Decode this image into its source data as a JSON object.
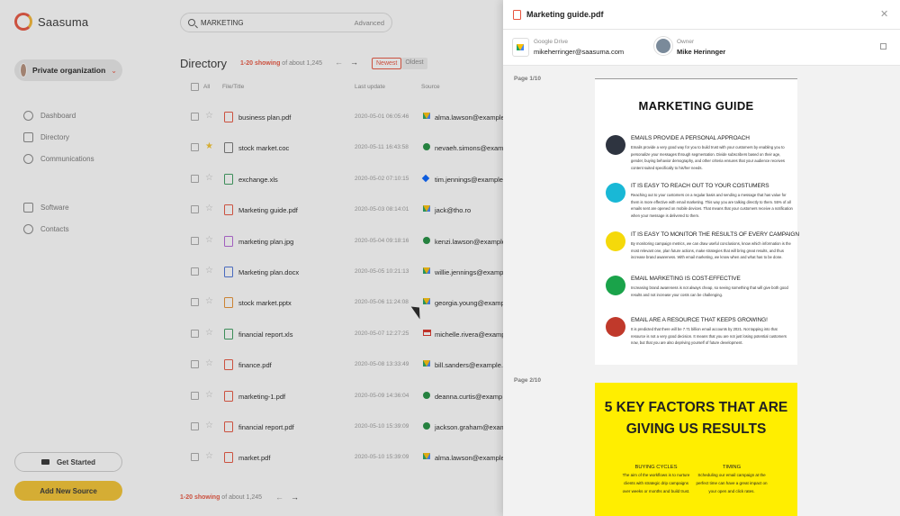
{
  "app": {
    "logo_text": "Saasuma",
    "org_label": "Private organization",
    "nav": [
      "Dashboard",
      "Directory",
      "Communications"
    ],
    "nav2": [
      "Software",
      "Contacts"
    ],
    "get_started": "Get Started",
    "add_source": "Add New Source"
  },
  "search": {
    "value": "MARKETING",
    "advanced": "Advanced"
  },
  "directory": {
    "title": "Directory",
    "showing": "1-20 showing",
    "of_total": "of about 1,245",
    "sort_newest": "Newest",
    "sort_oldest": "Oldest",
    "col_all": "All",
    "col_file": "File/Title",
    "col_update": "Last update",
    "col_source": "Source"
  },
  "rows": [
    {
      "name": "business plan.pdf",
      "type": "pdf",
      "date": "2020-05-01 06:05:46",
      "source": "drive",
      "email": "alma.lawson@example",
      "fav": false
    },
    {
      "name": "stock market.coc",
      "type": "coc",
      "date": "2020-05-11 16:43:58",
      "source": "hangout",
      "email": "nevaeh.simons@examp",
      "fav": true
    },
    {
      "name": "exchange.xls",
      "type": "xls",
      "date": "2020-05-02 07:10:15",
      "source": "dropbox",
      "email": "tim.jennings@example",
      "fav": false
    },
    {
      "name": "Marketing guide.pdf",
      "type": "pdf",
      "date": "2020-05-03 08:14:01",
      "source": "drive",
      "email": "jack@tho.ro",
      "fav": false
    },
    {
      "name": "marketing plan.jpg",
      "type": "jpg",
      "date": "2020-05-04 09:18:16",
      "source": "hangout",
      "email": "kenzi.lawson@example",
      "fav": false
    },
    {
      "name": "Marketing plan.docx",
      "type": "docx",
      "date": "2020-05-05 10:21:13",
      "source": "drive",
      "email": "willie.jennings@examp",
      "fav": false
    },
    {
      "name": "stock market.pptx",
      "type": "pptx",
      "date": "2020-05-06 11:24:08",
      "source": "drive",
      "email": "georgia.young@examp",
      "fav": false
    },
    {
      "name": "financial report.xls",
      "type": "xls",
      "date": "2020-05-07 12:27:25",
      "source": "gmail",
      "email": "michelle.rivera@examp",
      "fav": false
    },
    {
      "name": "finance.pdf",
      "type": "pdf",
      "date": "2020-05-08 13:33:49",
      "source": "drive",
      "email": "bill.sanders@example.",
      "fav": false
    },
    {
      "name": "marketing-1.pdf",
      "type": "pdf",
      "date": "2020-05-09 14:36:04",
      "source": "hangout",
      "email": "deanna.curtis@examp",
      "fav": false
    },
    {
      "name": "financial report.pdf",
      "type": "pdf",
      "date": "2020-05-10 15:39:09",
      "source": "hangout",
      "email": "jackson.graham@exam",
      "fav": false
    },
    {
      "name": "market.pdf",
      "type": "pdf",
      "date": "2020-05-10 15:39:09",
      "source": "drive",
      "email": "alma.lawson@example",
      "fav": false
    }
  ],
  "footer": {
    "showing": "1-20 showing",
    "of_total": "of about 1,245"
  },
  "panel": {
    "title": "Marketing guide.pdf",
    "source_label": "Google Drive",
    "source_account": "mikeherringer@saasuma.com",
    "owner_label": "Owner",
    "owner_name": "Mike Herinnger",
    "page1_label": "Page 1/10",
    "page2_label": "Page 2/10"
  },
  "pdf1": {
    "heading": "MARKETING GUIDE",
    "sections": [
      {
        "title": "EMAILS PROVIDE A PERSONAL APPROACH",
        "color": "#2e3440",
        "body": "Emails provide a very good way for you to build trust with your customers by enabling you to personalize your messages through segmentation. Divide subscribers based on their age, gender, buying behavior demography, and other criteria ensures that your audience receives content suited specifically to his/her needs."
      },
      {
        "title": "IT IS EASY TO REACH OUT TO YOUR COSTUMERS",
        "color": "#19b8d6",
        "body": "Reaching out to your customers on a regular basis and sending a message that has value for them is more effective with email marketing. This way you are talking directly to them. 55% of all emails sent are opened on mobile devices. That means that your customers receive a notification when your message is delivered to them."
      },
      {
        "title": "IT IS EASY TO MONITOR THE RESULTS OF EVERY CAMPAIGN",
        "color": "#f5d90a",
        "body": "By monitoring campaign metrics, we can draw useful conclusions, know which information is the most relevant one, plan future actions, make strategies that will bring great results, and thus increase brand awareness. With email marketing, we know when and what has to be done."
      },
      {
        "title": "EMAIL MARKETING IS COST-EFFECTIVE",
        "color": "#1aa34a",
        "body": "Increasing brand awareness is not always cheap, so seeing something that will give both good results and not increase your costs can be challenging."
      },
      {
        "title": "EMAIL ARE A RESOURCE THAT KEEPS GROWING!",
        "color": "#c0392b",
        "body": "It is predicted that there will be 7.71 billion email accounts by 2021. Not tapping into that resource is not a very good decision. It means that you are not just losing potential customers now, but that you are also depriving yourself of future development."
      }
    ]
  },
  "pdf2": {
    "heading_line1": "5 KEY FACTORS THAT ARE",
    "heading_line2": "GIVING US RESULTS",
    "col1_title": "BUYING CYCLES",
    "col1_body": "The aim of the workflows is to nurture clients with strategic drip campaigns over weeks or months and build trust.",
    "col2_title": "TIMING",
    "col2_body": "Scheduling our email campaign at the perfect time can have a great impact on your open and click rates."
  }
}
